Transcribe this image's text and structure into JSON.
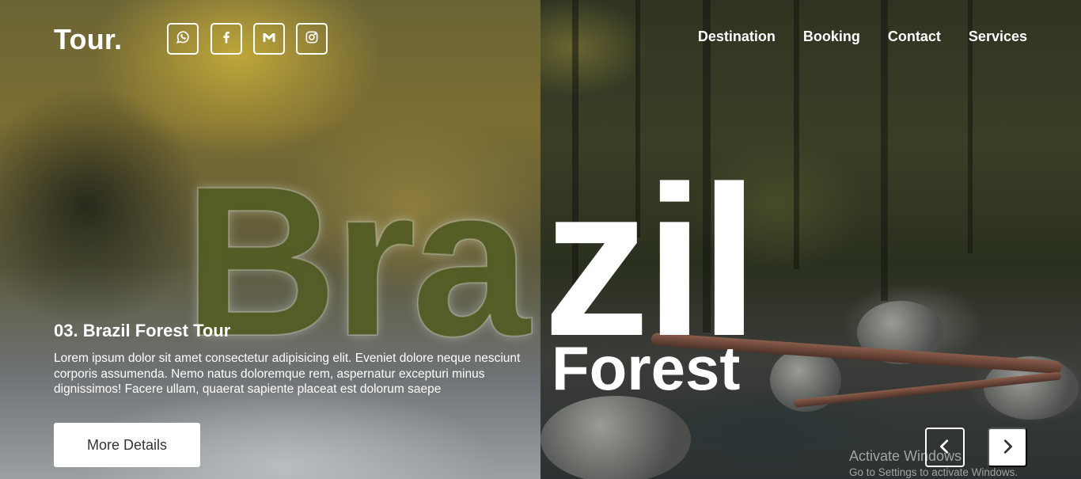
{
  "header": {
    "logo": "Tour.",
    "social": [
      {
        "icon": "whatsapp-icon"
      },
      {
        "icon": "facebook-icon"
      },
      {
        "icon": "gmail-icon"
      },
      {
        "icon": "instagram-icon"
      }
    ],
    "nav": [
      "Destination",
      "Booking",
      "Contact",
      "Services"
    ]
  },
  "hero": {
    "word_left": "Bra",
    "word_right": "zil",
    "subtitle": "Forest"
  },
  "tour": {
    "title": "03. Brazil Forest Tour",
    "description": "Lorem ipsum dolor sit amet consectetur adipisicing elit. Eveniet dolore neque nesciunt corporis assumenda. Nemo natus doloremque rem, aspernatur excepturi minus dignissimos! Facere ullam, quaerat sapiente placeat est dolorum saepe",
    "button_label": "More Details"
  },
  "slider": {
    "prev_icon": "chevron-left-icon",
    "next_icon": "chevron-right-icon"
  },
  "watermark": {
    "line1": "Activate Windows",
    "line2": "Go to Settings to activate Windows."
  },
  "colors": {
    "text": "#ffffff",
    "button_bg": "#ffffff",
    "button_text": "#333333"
  }
}
